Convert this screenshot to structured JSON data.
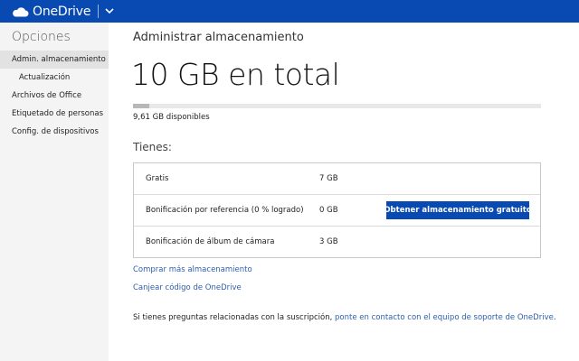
{
  "app": {
    "brand": "OneDrive",
    "accent": "#094ab2",
    "icons": {
      "logo": "cloud-icon",
      "menu": "chevron-down-icon"
    }
  },
  "sidebar": {
    "title": "Opciones",
    "items": [
      {
        "label": "Admin. almacenamiento",
        "active": true
      },
      {
        "label": "Actualización",
        "active": false
      },
      {
        "label": "Archivos de Office",
        "active": false
      },
      {
        "label": "Etiquetado de personas",
        "active": false
      },
      {
        "label": "Config. de dispositivos",
        "active": false
      }
    ]
  },
  "main": {
    "title": "Administrar almacenamiento",
    "total": "10 GB en total",
    "used_fraction": 0.039,
    "available": "9,61 GB disponibles",
    "have_heading": "Tienes:",
    "storage_rows": [
      {
        "name": "Gratis",
        "value": "7 GB"
      },
      {
        "name": "Bonificación por referencia (0 % logrado)",
        "value": "0 GB",
        "button": "Obtener almacenamiento gratuito"
      },
      {
        "name": "Bonificación de álbum de cámara",
        "value": "3 GB"
      }
    ],
    "links": {
      "buy_more": "Comprar más almacenamiento",
      "redeem": "Canjear código de OneDrive"
    },
    "footer": {
      "text": "Si tienes preguntas relacionadas con la suscripción,",
      "link": "ponte en contacto con el equipo de soporte de OneDrive",
      "end": "."
    }
  }
}
